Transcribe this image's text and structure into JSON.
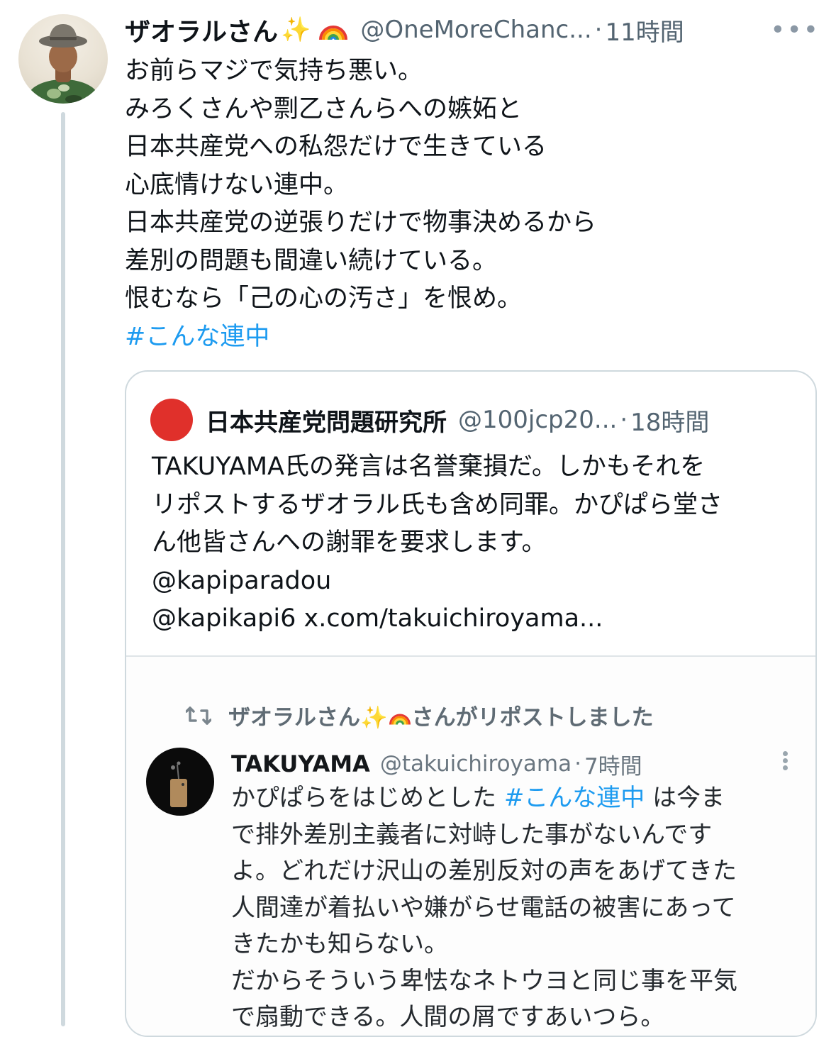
{
  "post": {
    "display_name": "ザオラルさん",
    "name_emoji_sparkle": "✨",
    "name_emoji_rainbow": "rainbow-emoji",
    "handle": "@OneMoreChanc...",
    "separator": "·",
    "time": "11時間",
    "more_icon": "more-horizontal-icon",
    "body_lines": [
      "お前らマジで気持ち悪い。",
      "みろくさんや剽乙さんらへの嫉妬と",
      "日本共産党への私怨だけで生きている",
      "心底情けない連中。",
      "日本共産党の逆張りだけで物事決めるから",
      "差別の問題も間違い続けている。",
      "恨むなら「己の心の汚さ」を恨め。"
    ],
    "hashtag": "#こんな連中"
  },
  "quote": {
    "display_name": "日本共産党問題研究所",
    "handle": "@100jcp20...",
    "separator": "·",
    "time": "18時間",
    "avatar_color": "#e0302b",
    "body_lines": [
      "TAKUYAMA氏の発言は名誉棄損だ。しかもそれを",
      "リポストするザオラル氏も含め同罪。かぴぱら堂さ",
      "ん他皆さんへの謝罪を要求します。",
      "@kapiparadou",
      "@kapikapi6 x.com/takuichiroyama..."
    ]
  },
  "embedded": {
    "repost_icon": "repost-icon",
    "repost_text_prefix": "ザオラルさん",
    "repost_text_sparkle": "✨",
    "repost_text_suffix": "さんがリポストしました",
    "display_name": "TAKUYAMA",
    "handle": "@takuichiroyama",
    "separator": "·",
    "time": "7時間",
    "more_icon": "more-vertical-icon",
    "line1_before": "かぴぱらをはじめとした ",
    "line1_tag": "#こんな連中",
    "line1_after": " は今ま",
    "body_lines": [
      "で排外差別主義者に対峙した事がないんです",
      "よ。どれだけ沢山の差別反対の声をあげてきた",
      "人間達が着払いや嫌がらせ電話の被害にあって",
      "きたかも知らない。",
      "だからそういう卑怯なネトウヨと同じ事を平気",
      "で扇動できる。人間の屑ですあいつら。"
    ]
  },
  "colors": {
    "link": "#1d9bf0",
    "secondary_text": "#536471",
    "border": "#cfd9de",
    "quote_avatar": "#e0302b"
  }
}
